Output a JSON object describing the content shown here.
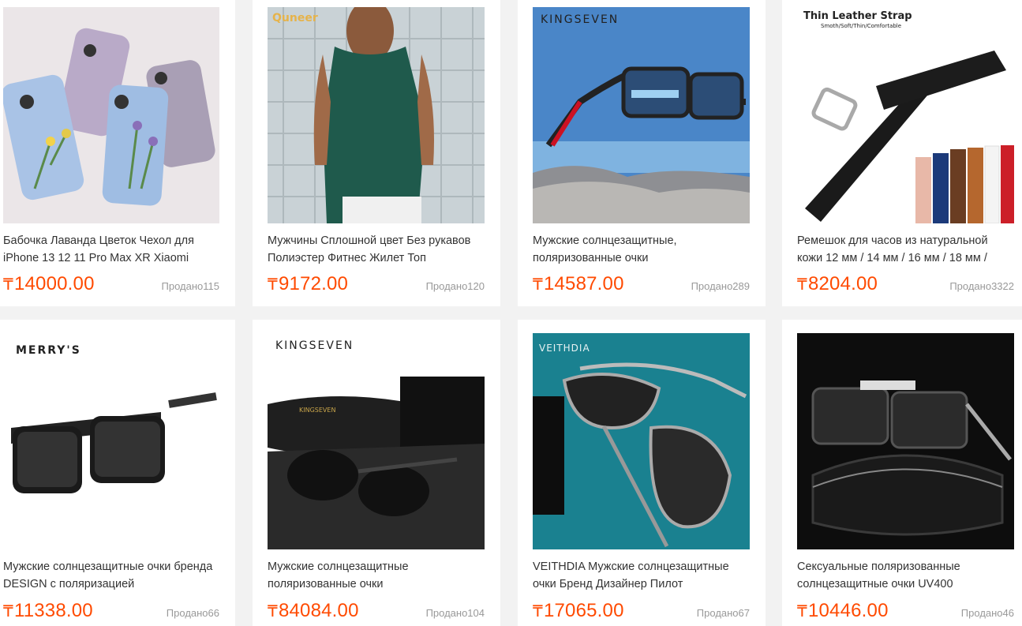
{
  "currency_symbol": "₸",
  "products": [
    {
      "title": "Бабочка Лаванда Цветок Чехол для iPhone 13 12 11 Pro Max XR Xiaomi",
      "price": "14000.00",
      "sold": "Продано115",
      "image_icon": "phone-cases-image"
    },
    {
      "title": "Мужчины Сплошной цвет Без рукавов Полиэстер Фитнес Жилет Топ",
      "price": "9172.00",
      "sold": "Продано120",
      "image_icon": "tank-top-image",
      "image_text": "Quneer"
    },
    {
      "title": "Мужские солнцезащитные, поляризованные очки",
      "price": "14587.00",
      "sold": "Продано289",
      "image_icon": "sunglasses-image",
      "image_text": "KINGSEVEN"
    },
    {
      "title": "Ремешок для часов из натуральной кожи 12 мм / 14 мм / 16 мм / 18 мм /",
      "price": "8204.00",
      "sold": "Продано3322",
      "image_icon": "watch-strap-image",
      "image_text": "Thin Leather Strap",
      "image_subtext": "Smoth/Soft/Thin/Comfortable"
    },
    {
      "title": "Мужские солнцезащитные очки бренда DESIGN с поляризацией",
      "price": "11338.00",
      "sold": "Продано66",
      "image_icon": "sunglasses-image",
      "image_text": "MERRY'S"
    },
    {
      "title": "Мужские солнцезащитные поляризованные очки",
      "price": "84084.00",
      "sold": "Продано104",
      "image_icon": "sunglasses-case-image",
      "image_text": "KINGSEVEN"
    },
    {
      "title": "VEITHDIA Мужские солнцезащитные очки Бренд Дизайнер Пилот",
      "price": "17065.00",
      "sold": "Продано67",
      "image_icon": "aviator-sunglasses-image",
      "image_text": "VEITHDIA"
    },
    {
      "title": "Сексуальные поляризованные солнцезащитные очки UV400",
      "price": "10446.00",
      "sold": "Продано46",
      "image_icon": "sunglasses-image"
    }
  ]
}
